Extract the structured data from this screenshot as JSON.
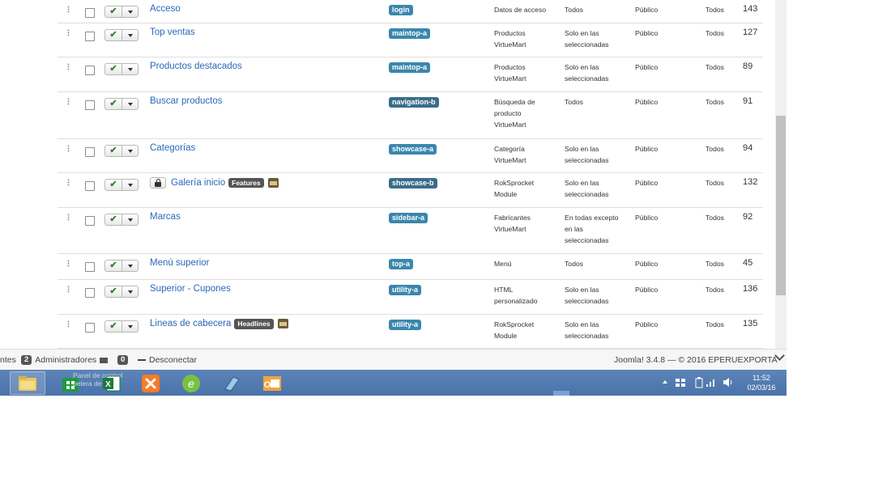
{
  "rows": [
    {
      "title": "Acceso",
      "position": "login",
      "type": [
        "Datos de acceso"
      ],
      "pages": [
        "Todos"
      ],
      "access": "Público",
      "language": "Todos",
      "id": "143",
      "locked": false,
      "tag": ""
    },
    {
      "title": "Top ventas",
      "position": "maintop-a",
      "type": [
        "Productos",
        "VirtueMart"
      ],
      "pages": [
        "Solo en las",
        "seleccionadas"
      ],
      "access": "Público",
      "language": "Todos",
      "id": "127",
      "locked": false,
      "tag": ""
    },
    {
      "title": "Productos destacados",
      "position": "maintop-a",
      "type": [
        "Productos",
        "VirtueMart"
      ],
      "pages": [
        "Solo en las",
        "seleccionadas"
      ],
      "access": "Público",
      "language": "Todos",
      "id": "89",
      "locked": false,
      "tag": ""
    },
    {
      "title": "Buscar productos",
      "position": "navigation-b",
      "type": [
        "Búsqueda de",
        "producto",
        "VirtueMart"
      ],
      "pages": [
        "Todos"
      ],
      "access": "Público",
      "language": "Todos",
      "id": "91",
      "locked": false,
      "tag": ""
    },
    {
      "title": "Categorías",
      "position": "showcase-a",
      "type": [
        "Categoría",
        "VirtueMart"
      ],
      "pages": [
        "Solo en las",
        "seleccionadas"
      ],
      "access": "Público",
      "language": "Todos",
      "id": "94",
      "locked": false,
      "tag": ""
    },
    {
      "title": "Galería inicio",
      "position": "showcase-b",
      "type": [
        "RokSprocket",
        "Module"
      ],
      "pages": [
        "Solo en las",
        "seleccionadas"
      ],
      "access": "Público",
      "language": "Todos",
      "id": "132",
      "locked": true,
      "tag": "Features"
    },
    {
      "title": "Marcas",
      "position": "sidebar-a",
      "type": [
        "Fabricantes",
        "VirtueMart"
      ],
      "pages": [
        "En todas excepto",
        "en las",
        "seleccionadas"
      ],
      "access": "Público",
      "language": "Todos",
      "id": "92",
      "locked": false,
      "tag": ""
    },
    {
      "title": "Menú superior",
      "position": "top-a",
      "type": [
        "Menú"
      ],
      "pages": [
        "Todos"
      ],
      "access": "Público",
      "language": "Todos",
      "id": "45",
      "locked": false,
      "tag": ""
    },
    {
      "title": "Superior - Cupones",
      "position": "utility-a",
      "type": [
        "HTML",
        "personalizado"
      ],
      "pages": [
        "Solo en las",
        "seleccionadas"
      ],
      "access": "Público",
      "language": "Todos",
      "id": "136",
      "locked": false,
      "tag": ""
    },
    {
      "title": "Lineas de cabecera",
      "position": "utility-a",
      "type": [
        "RokSprocket",
        "Module"
      ],
      "pages": [
        "Solo en las",
        "seleccionadas"
      ],
      "access": "Público",
      "language": "Todos",
      "id": "135",
      "locked": false,
      "tag": "Headlines"
    }
  ],
  "statusbar": {
    "visitors_label": "ntes",
    "admins_count": "2",
    "admins_label": "Administradores",
    "messages_count": "0",
    "logout_label": "Desconectar",
    "footer": "Joomla! 3.4.8 — © 2016 EPERUEXPORTA"
  },
  "taskbar": {
    "tooltip_line1": "Panel de control",
    "tooltip_line2": "pelera de recic",
    "time": "11:52",
    "date": "02/03/16"
  },
  "colors": {
    "link": "#2a69b8",
    "position_badge": "#3a87ad",
    "taskbar": "#4a73aa"
  }
}
